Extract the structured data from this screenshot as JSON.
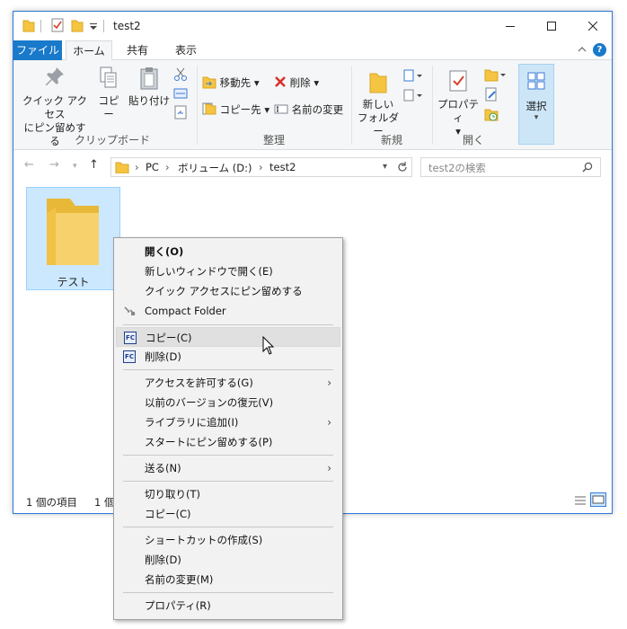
{
  "window": {
    "title": "test2",
    "tabs": {
      "file": "ファイル",
      "home": "ホーム",
      "share": "共有",
      "view": "表示"
    },
    "help": "?",
    "accent": "#1979ca"
  },
  "ribbon": {
    "clipboard": {
      "pin_label_1": "クイック アクセス",
      "pin_label_2": "にピン留めする",
      "copy": "コピー",
      "paste": "貼り付け",
      "group": "クリップボード"
    },
    "organize": {
      "move_to": "移動先",
      "copy_to": "コピー先",
      "delete": "削除",
      "rename": "名前の変更",
      "group": "整理"
    },
    "new": {
      "new_folder_1": "新しい",
      "new_folder_2": "フォルダー",
      "group": "新規"
    },
    "open": {
      "properties": "プロパティ",
      "group": "開く"
    },
    "select": {
      "label": "選択"
    }
  },
  "address": {
    "crumbs": [
      "PC",
      "ボリューム (D:)",
      "test2"
    ],
    "search_placeholder": "test2の検索"
  },
  "content": {
    "folder_name": "テスト"
  },
  "status": {
    "items": "1 個の項目",
    "selected": "1 個"
  },
  "context_menu": {
    "items": [
      "開く(O)",
      "新しいウィンドウで開く(E)",
      "クイック アクセスにピン留めする",
      "Compact Folder",
      "コピー(C)",
      "削除(D)",
      "アクセスを許可する(G)",
      "以前のバージョンの復元(V)",
      "ライブラリに追加(I)",
      "スタートにピン留めする(P)",
      "送る(N)",
      "切り取り(T)",
      "コピー(C)",
      "ショートカットの作成(S)",
      "削除(D)",
      "名前の変更(M)",
      "プロパティ(R)"
    ],
    "fc_badge": "FC"
  }
}
